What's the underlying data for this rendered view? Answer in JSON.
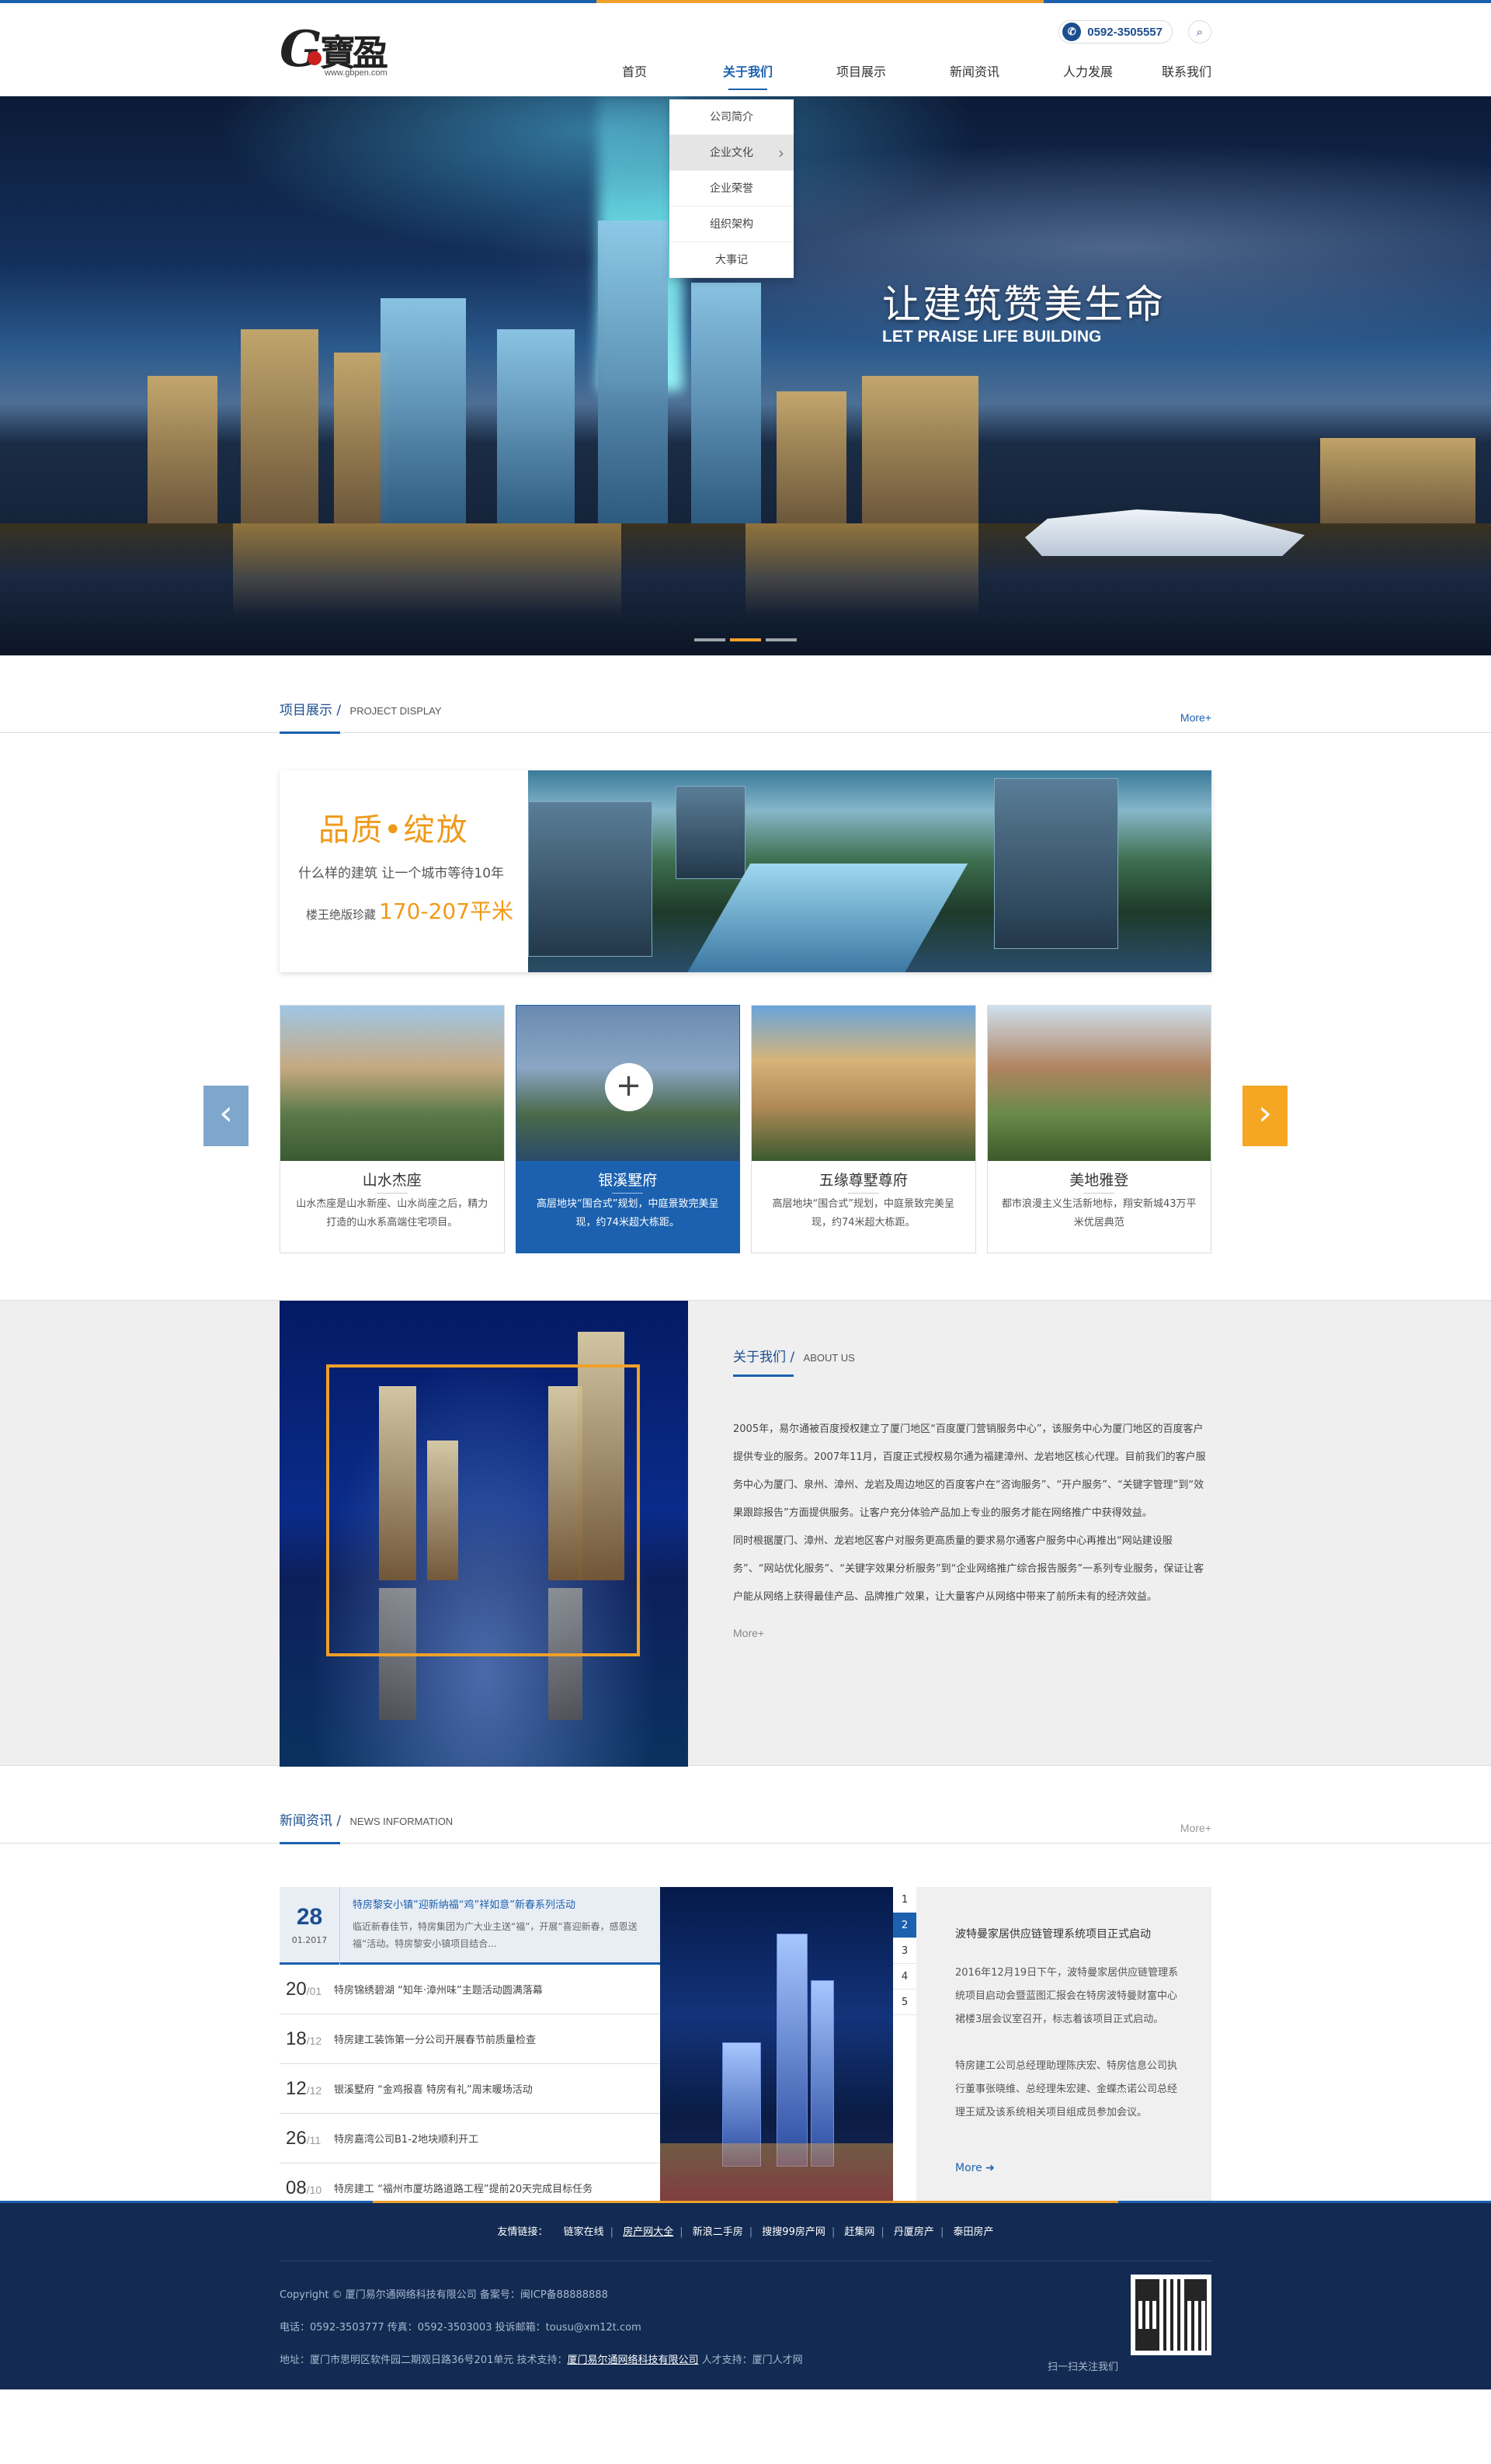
{
  "header": {
    "logo_cn": "寶盈",
    "logo_g": "G",
    "logo_url": "www.gbpen.com",
    "phone": "0592-3505557",
    "phone_icon": "phone-icon",
    "search_icon": "search-icon",
    "nav": [
      "首页",
      "关于我们",
      "项目展示",
      "新闻资讯",
      "人力发展",
      "联系我们"
    ],
    "nav_active": "关于我们",
    "dropdown": [
      "公司简介",
      "企业文化",
      "企业荣誉",
      "组织架构",
      "大事记"
    ]
  },
  "banner": {
    "title": "让建筑赞美生命",
    "subtitle": "LET PRAISE LIFE BUILDING",
    "slides": 3,
    "active_slide": 1
  },
  "projects": {
    "title": "项目展示",
    "title_en": "PROJECT DISPLAY",
    "more": "More+",
    "feature": {
      "headline": "品质•绽放",
      "line2": "什么样的建筑 让一个城市等待10年",
      "line3_prefix": "楼王绝版珍藏",
      "line3_value": "170-207平米"
    },
    "cards": [
      {
        "name": "山水杰座",
        "desc": "山水杰座是山水新座、山水尚座之后，精力打造的山水系高端住宅项目。"
      },
      {
        "name": "银溪墅府",
        "desc": "高层地块“围合式”规划，中庭景致完美呈现，约74米超大栋距。"
      },
      {
        "name": "五缘尊墅尊府",
        "desc": "高层地块“围合式”规划，中庭景致完美呈现，约74米超大栋距。"
      },
      {
        "name": "美地雅登",
        "desc": "都市浪漫主义生活新地标，翔安新城43万平米优居典范"
      }
    ],
    "selected_card": 1,
    "plus_icon": "plus-icon",
    "prev_icon": "chevron-left-icon",
    "next_icon": "chevron-right-icon"
  },
  "about": {
    "title": "关于我们",
    "title_en": "ABOUT US",
    "para1": "2005年，易尔通被百度授权建立了厦门地区“百度厦门营销服务中心”，该服务中心为厦门地区的百度客户提供专业的服务。2007年11月，百度正式授权易尔通为福建漳州、龙岩地区核心代理。目前我们的客户服务中心为厦门、泉州、漳州、龙岩及周边地区的百度客户在“咨询服务”、“开户服务”、“关键字管理”到“效果跟踪报告”方面提供服务。让客户充分体验产品加上专业的服务才能在网络推广中获得效益。",
    "para2": "同时根据厦门、漳州、龙岩地区客户对服务更高质量的要求易尔通客户服务中心再推出“网站建设服务”、“网站优化服务”、“关键字效果分析服务”到“企业网络推广综合报告服务”一系列专业服务，保证让客户能从网络上获得最佳产品、品牌推广效果，让大量客户从网络中带来了前所未有的经济效益。",
    "more": "More+"
  },
  "news": {
    "title": "新闻资讯",
    "title_en": "NEWS INFORMATION",
    "more": "More+",
    "top": {
      "day": "28",
      "month": "01.2017",
      "title": "特房黎安小镇”迎新纳福“鸡”祥如意”新春系列活动",
      "summary": "临近新春佳节，特房集团为广大业主送“福”，开展”喜迎新春，感恩送福“活动。特房黎安小镇项目结合..."
    },
    "items": [
      {
        "day": "20",
        "month": "/01",
        "title": "特房锦绣碧湖 “知年·漳州味”主题活动圆满落幕"
      },
      {
        "day": "18",
        "month": "/12",
        "title": "特房建工装饰第一分公司开展春节前质量检查"
      },
      {
        "day": "12",
        "month": "/12",
        "title": "银溪墅府 “金鸡报喜 特房有礼”周末暖场活动"
      },
      {
        "day": "26",
        "month": "/11",
        "title": "特房嘉湾公司B1-2地块顺利开工"
      },
      {
        "day": "08",
        "month": "/10",
        "title": "特房建工 “福州市厦坊路道路工程”提前20天完成目标任务"
      }
    ],
    "numbers": [
      "1",
      "2",
      "3",
      "4",
      "5"
    ],
    "active_number": 1,
    "detail": {
      "title": "波特曼家居供应链管理系统项目正式启动",
      "p1": "2016年12月19日下午，波特曼家居供应链管理系统项目启动会暨蓝图汇报会在特房波特曼财富中心裙楼3层会议室召开，标志着该项目正式启动。",
      "p2": "特房建工公司总经理助理陈庆宏、特房信息公司执行董事张晓维、总经理朱宏建、金蝶杰诺公司总经理王斌及该系统相关项目组成员参加会议。",
      "more": "More",
      "more_icon": "circle-arrow-right-icon"
    }
  },
  "footer": {
    "links_label": "友情链接：",
    "links": [
      "链家在线",
      "房产网大全",
      "新浪二手房",
      "搜搜99房产网",
      "赶集网",
      "丹厦房产",
      "泰田房产"
    ],
    "copyright": "Copyright ©  厦门易尔通网络科技有限公司   备案号：闽ICP备88888888",
    "contact": "电话：0592-3503777    传真：0592-3503003    投诉邮箱：tousu@xm12t.com",
    "address_prefix": "地址：厦门市思明区软件园二期观日路36号201单元    技术支持：",
    "support": "厦门易尔通网络科技有限公司",
    "talent": "   人才支持：厦门人才网",
    "scan": "扫一扫关注我们",
    "qr_icon": "qr-code-icon"
  }
}
